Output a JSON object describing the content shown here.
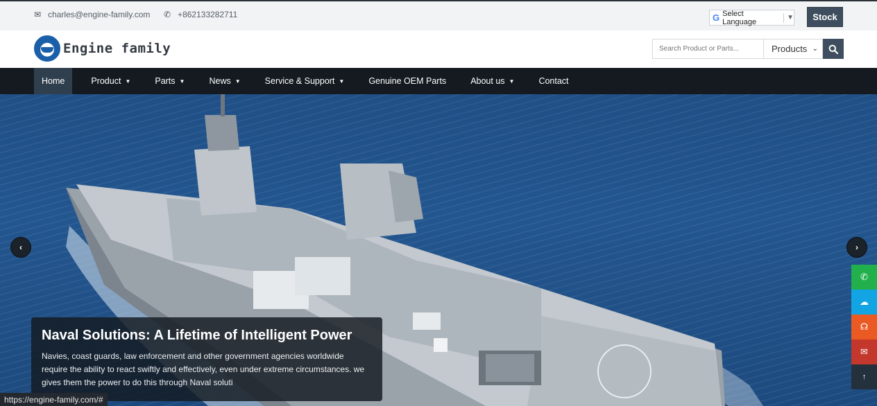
{
  "topbar": {
    "email": "charles@engine-family.com",
    "email_icon": "envelope-icon",
    "phone": "+862133282711",
    "phone_icon": "phone-icon",
    "language": {
      "logo": "G",
      "label": "Select Language",
      "arrow": "▼"
    },
    "stock_label": "Stock"
  },
  "header": {
    "logo_text": "Engine family",
    "search": {
      "placeholder": "Search Product or Parts...",
      "category": "Products",
      "button_icon": "search-icon"
    }
  },
  "nav": {
    "items": [
      {
        "label": "Home",
        "active": true,
        "dropdown": false
      },
      {
        "label": "Product",
        "dropdown": true
      },
      {
        "label": "Parts",
        "dropdown": true
      },
      {
        "label": "News",
        "dropdown": true
      },
      {
        "label": "Service & Support",
        "dropdown": true
      },
      {
        "label": "Genuine OEM Parts",
        "dropdown": false
      },
      {
        "label": "About us",
        "dropdown": true
      },
      {
        "label": "Contact",
        "dropdown": false
      }
    ],
    "caret": "▼"
  },
  "hero": {
    "title": "Naval Solutions: A Lifetime of Intelligent Power",
    "text": "Navies, coast guards, law enforcement and other government agencies worldwide require the ability to react swiftly and effectively, even under extreme circumstances. we gives them the power to do this through Naval soluti",
    "prev_icon": "‹",
    "next_icon": "›"
  },
  "side_buttons": [
    {
      "name": "whatsapp-icon",
      "glyph": "✆",
      "color": "#21b04b"
    },
    {
      "name": "wechat-icon",
      "glyph": "☁",
      "color": "#13a4e3"
    },
    {
      "name": "headset-icon",
      "glyph": "☊",
      "color": "#ec5a24"
    },
    {
      "name": "mail-icon",
      "glyph": "✉",
      "color": "#c4372c"
    },
    {
      "name": "back-to-top-icon",
      "glyph": "↑",
      "color": "#24303b"
    }
  ],
  "status_bar": "https://engine-family.com/#"
}
